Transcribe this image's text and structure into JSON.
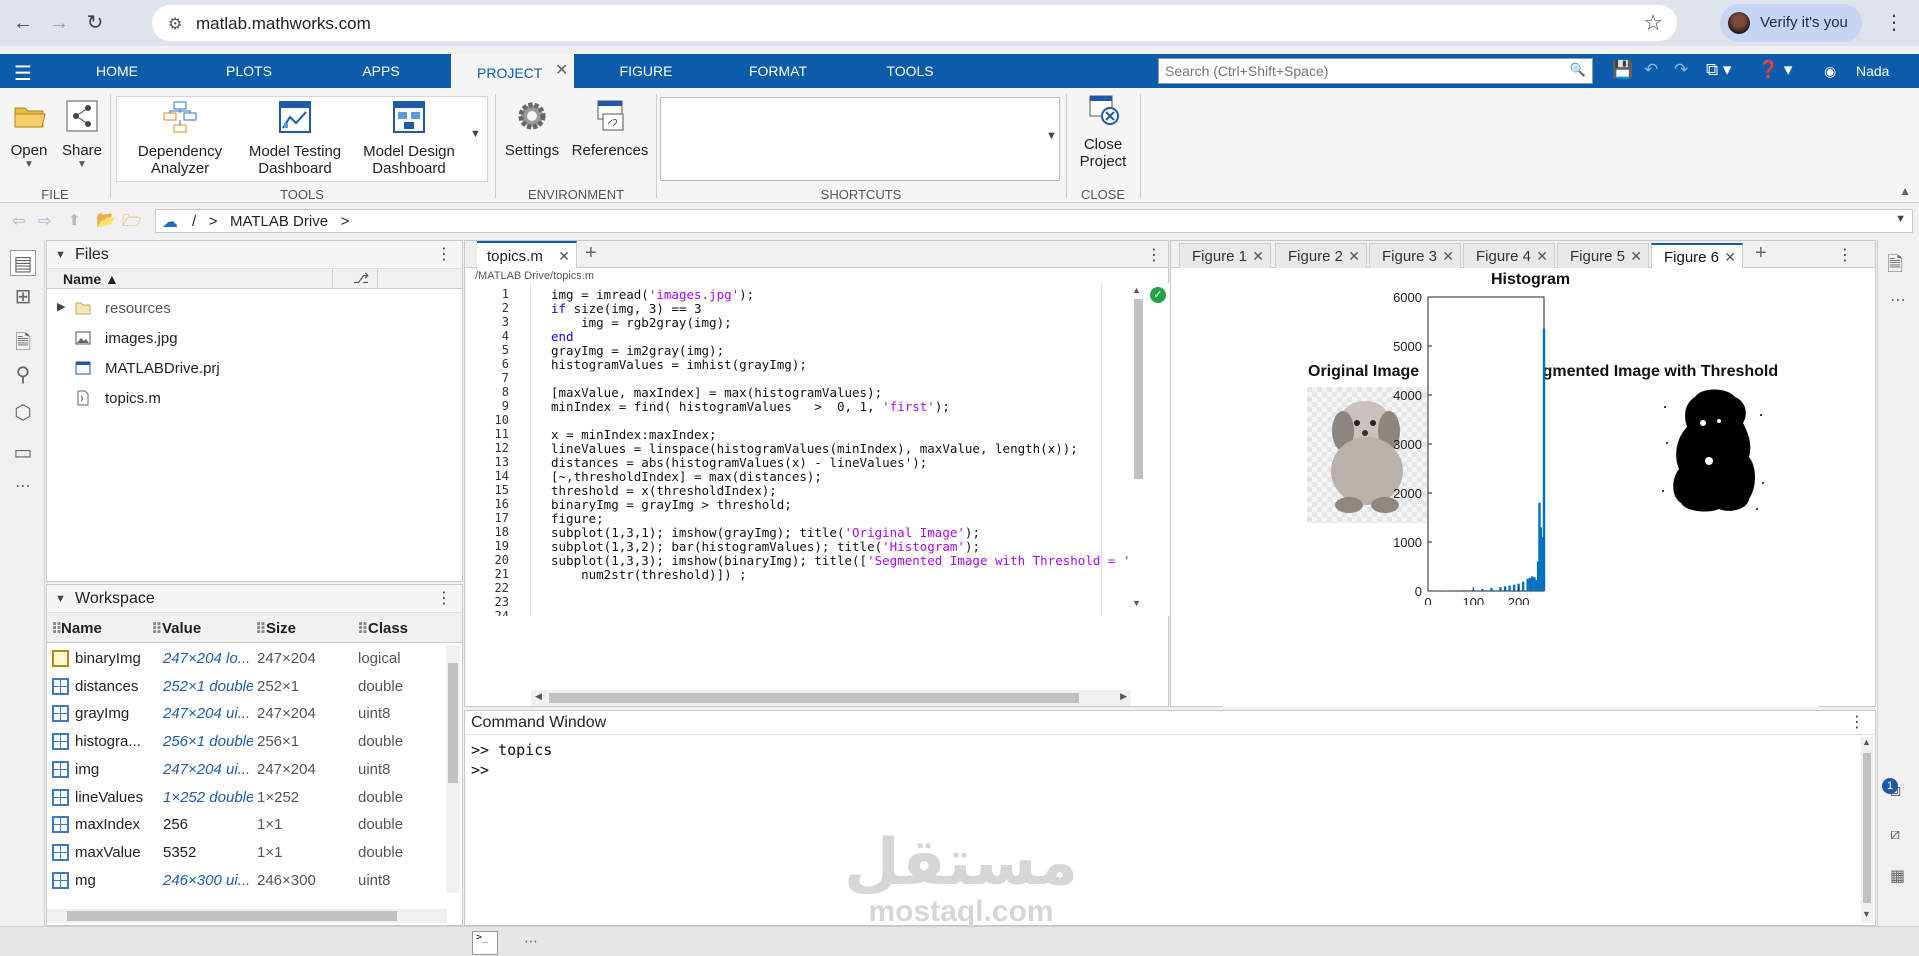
{
  "browser": {
    "url": "matlab.mathworks.com",
    "verify_label": "Verify it's you"
  },
  "toolstrip": {
    "tabs": [
      "HOME",
      "PLOTS",
      "APPS",
      "PROJECT",
      "FIGURE",
      "FORMAT",
      "TOOLS"
    ],
    "active_tab": "PROJECT",
    "search_placeholder": "Search (Ctrl+Shift+Space)",
    "user": "Nada"
  },
  "ribbon": {
    "file": {
      "open": "Open",
      "share": "Share",
      "label": "FILE"
    },
    "tools": {
      "dependency_1": "Dependency",
      "dependency_2": "Analyzer",
      "testing_1": "Model Testing",
      "testing_2": "Dashboard",
      "design_1": "Model Design",
      "design_2": "Dashboard",
      "label": "TOOLS"
    },
    "environment": {
      "settings": "Settings",
      "references": "References",
      "label": "ENVIRONMENT"
    },
    "shortcuts": {
      "label": "SHORTCUTS"
    },
    "close": {
      "close_1": "Close",
      "close_2": "Project",
      "label": "CLOSE"
    }
  },
  "address": {
    "root": "/",
    "sep": ">",
    "location": "MATLAB Drive",
    "sep2": ">"
  },
  "files": {
    "title": "Files",
    "col_name": "Name ▲",
    "items": [
      {
        "name": "resources",
        "icon": "folder-icon"
      },
      {
        "name": "images.jpg",
        "icon": "image-file-icon"
      },
      {
        "name": "MATLABDrive.prj",
        "icon": "project-file-icon"
      },
      {
        "name": "topics.m",
        "icon": "script-file-icon"
      }
    ]
  },
  "workspace": {
    "title": "Workspace",
    "cols": {
      "name": "Name",
      "value": "Value",
      "size": "Size",
      "class": "Class"
    },
    "rows": [
      {
        "name": "binaryImg",
        "value": "247×204 lo...",
        "size": "247×204",
        "class": "logical"
      },
      {
        "name": "distances",
        "value": "252×1 double",
        "size": "252×1",
        "class": "double"
      },
      {
        "name": "grayImg",
        "value": "247×204 ui...",
        "size": "247×204",
        "class": "uint8"
      },
      {
        "name": "histogra...",
        "value": "256×1 double",
        "size": "256×1",
        "class": "double"
      },
      {
        "name": "img",
        "value": "247×204 ui...",
        "size": "247×204",
        "class": "uint8"
      },
      {
        "name": "lineValues",
        "value": "1×252 double",
        "size": "1×252",
        "class": "double"
      },
      {
        "name": "maxIndex",
        "value": "256",
        "size": "1×1",
        "class": "double"
      },
      {
        "name": "maxValue",
        "value": "5352",
        "size": "1×1",
        "class": "double"
      },
      {
        "name": "mg",
        "value": "246×300 ui...",
        "size": "246×300",
        "class": "uint8"
      }
    ]
  },
  "editor": {
    "tab": "topics.m",
    "path": "/MATLAB Drive/topics.m",
    "lines": [
      "img = imread('images.jpg');",
      "if size(img, 3) == 3",
      "    img = rgb2gray(img);",
      "end",
      "grayImg = im2gray(img);",
      "histogramValues = imhist(grayImg);",
      "",
      "[maxValue, maxIndex] = max(histogramValues);",
      "minIndex = find( histogramValues   >  0, 1, 'first');",
      "",
      "x = minIndex:maxIndex;",
      "lineValues = linspace(histogramValues(minIndex), maxValue, length(x));",
      "distances = abs(histogramValues(x) - lineValues');",
      "[~,thresholdIndex] = max(distances);",
      "threshold = x(thresholdIndex);",
      "binaryImg = grayImg > threshold;",
      "figure;",
      "subplot(1,3,1); imshow(grayImg); title('Original Image');",
      "subplot(1,3,2); bar(histogramValues); title('Histogram');",
      "subplot(1,3,3); imshow(binaryImg); title(['Segmented Image with Threshold = '",
      "    num2str(threshold)]) ;",
      "",
      "",
      ""
    ]
  },
  "figures": {
    "tabs": [
      "Figure 1",
      "Figure 2",
      "Figure 3",
      "Figure 4",
      "Figure 5",
      "Figure 6"
    ],
    "active": "Figure 6",
    "subplot1_title": "Original Image",
    "subplot3_title": "Segmented Image with Threshold"
  },
  "chart_data": {
    "type": "bar",
    "title": "Histogram",
    "xlabel": "",
    "ylabel": "",
    "xlim": [
      0,
      256
    ],
    "ylim": [
      0,
      6000
    ],
    "xticks": [
      0,
      100,
      200
    ],
    "yticks": [
      0,
      1000,
      2000,
      3000,
      4000,
      5000,
      6000
    ],
    "x": [
      20,
      40,
      60,
      80,
      100,
      120,
      140,
      160,
      170,
      180,
      190,
      200,
      210,
      220,
      225,
      230,
      235,
      240,
      243,
      246,
      249,
      252,
      254,
      256
    ],
    "values": [
      5,
      8,
      12,
      18,
      25,
      40,
      60,
      80,
      95,
      110,
      130,
      150,
      190,
      250,
      270,
      300,
      280,
      220,
      600,
      1800,
      1300,
      400,
      1100,
      5352
    ],
    "color": "#0072bd"
  },
  "command_window": {
    "title": "Command Window",
    "lines": [
      ">> topics",
      ">>"
    ]
  },
  "watermark": {
    "arabic": "مستقل",
    "latin": "mostaql.com"
  },
  "notification_count": "1"
}
